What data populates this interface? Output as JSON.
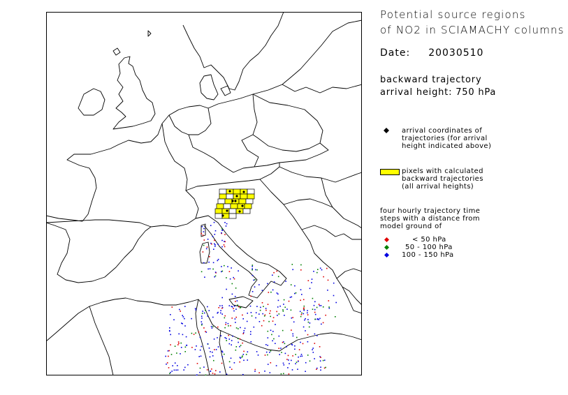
{
  "legend": {
    "title_line1": "Potential source regions",
    "title_line2": "of NO2 in SCIAMACHY columns",
    "date_label": "Date:",
    "date_value": "20030510",
    "traj_line1": "backward trajectory",
    "traj_line2": "arrival height: 750 hPa",
    "arrival_l1": "arrival coordinates of",
    "arrival_l2": "trajectories (for arrival",
    "arrival_l3": "height indicated above)",
    "pixels_l1": "pixels with calculated",
    "pixels_l2": "backward trajectories",
    "pixels_l3": "(all arrival heights)",
    "steps_l1": "four hourly trajectory time",
    "steps_l2": "steps with a distance from",
    "steps_l3": "model ground of",
    "range_1": "< 50 hPa",
    "range_2": "50 - 100 hPa",
    "range_3": "100 - 150 hPa"
  },
  "colors": {
    "arrival": "#000000",
    "pixel_fill": "#ffff00",
    "lt50": "#e00000",
    "r50_100": "#008000",
    "r100_150": "#0000e0"
  }
}
